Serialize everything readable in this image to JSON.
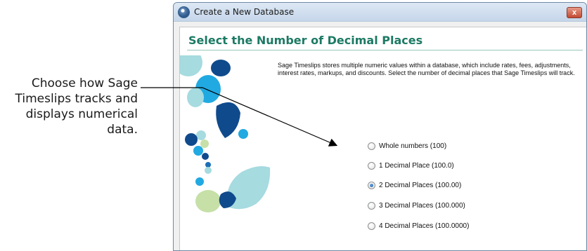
{
  "callout": {
    "lines": [
      "Choose how Sage",
      "Timeslips tracks and",
      "displays numerical",
      "data."
    ]
  },
  "window": {
    "title": "Create a New Database",
    "close_label": "x",
    "icon": "sage-app-icon"
  },
  "page": {
    "heading": "Select the Number of Decimal Places",
    "description": "Sage Timeslips stores multiple numeric values within a database, which include rates, fees, adjustments, interest rates, markups, and discounts. Select the number of decimal places that Sage Timeslips will track."
  },
  "options": [
    {
      "label": "Whole numbers (100)",
      "checked": false
    },
    {
      "label": "1 Decimal Place (100.0)",
      "checked": false
    },
    {
      "label": "2 Decimal Places (100.00)",
      "checked": true
    },
    {
      "label": "3 Decimal Places (100.000)",
      "checked": false
    },
    {
      "label": "4 Decimal Places (100.0000)",
      "checked": false
    }
  ],
  "colors": {
    "heading": "#1c7a64",
    "art_dark_blue": "#0f4a8c",
    "art_cyan": "#21a9e1",
    "art_light_teal": "#a6dbe0",
    "art_light_green": "#c6e0a8"
  }
}
